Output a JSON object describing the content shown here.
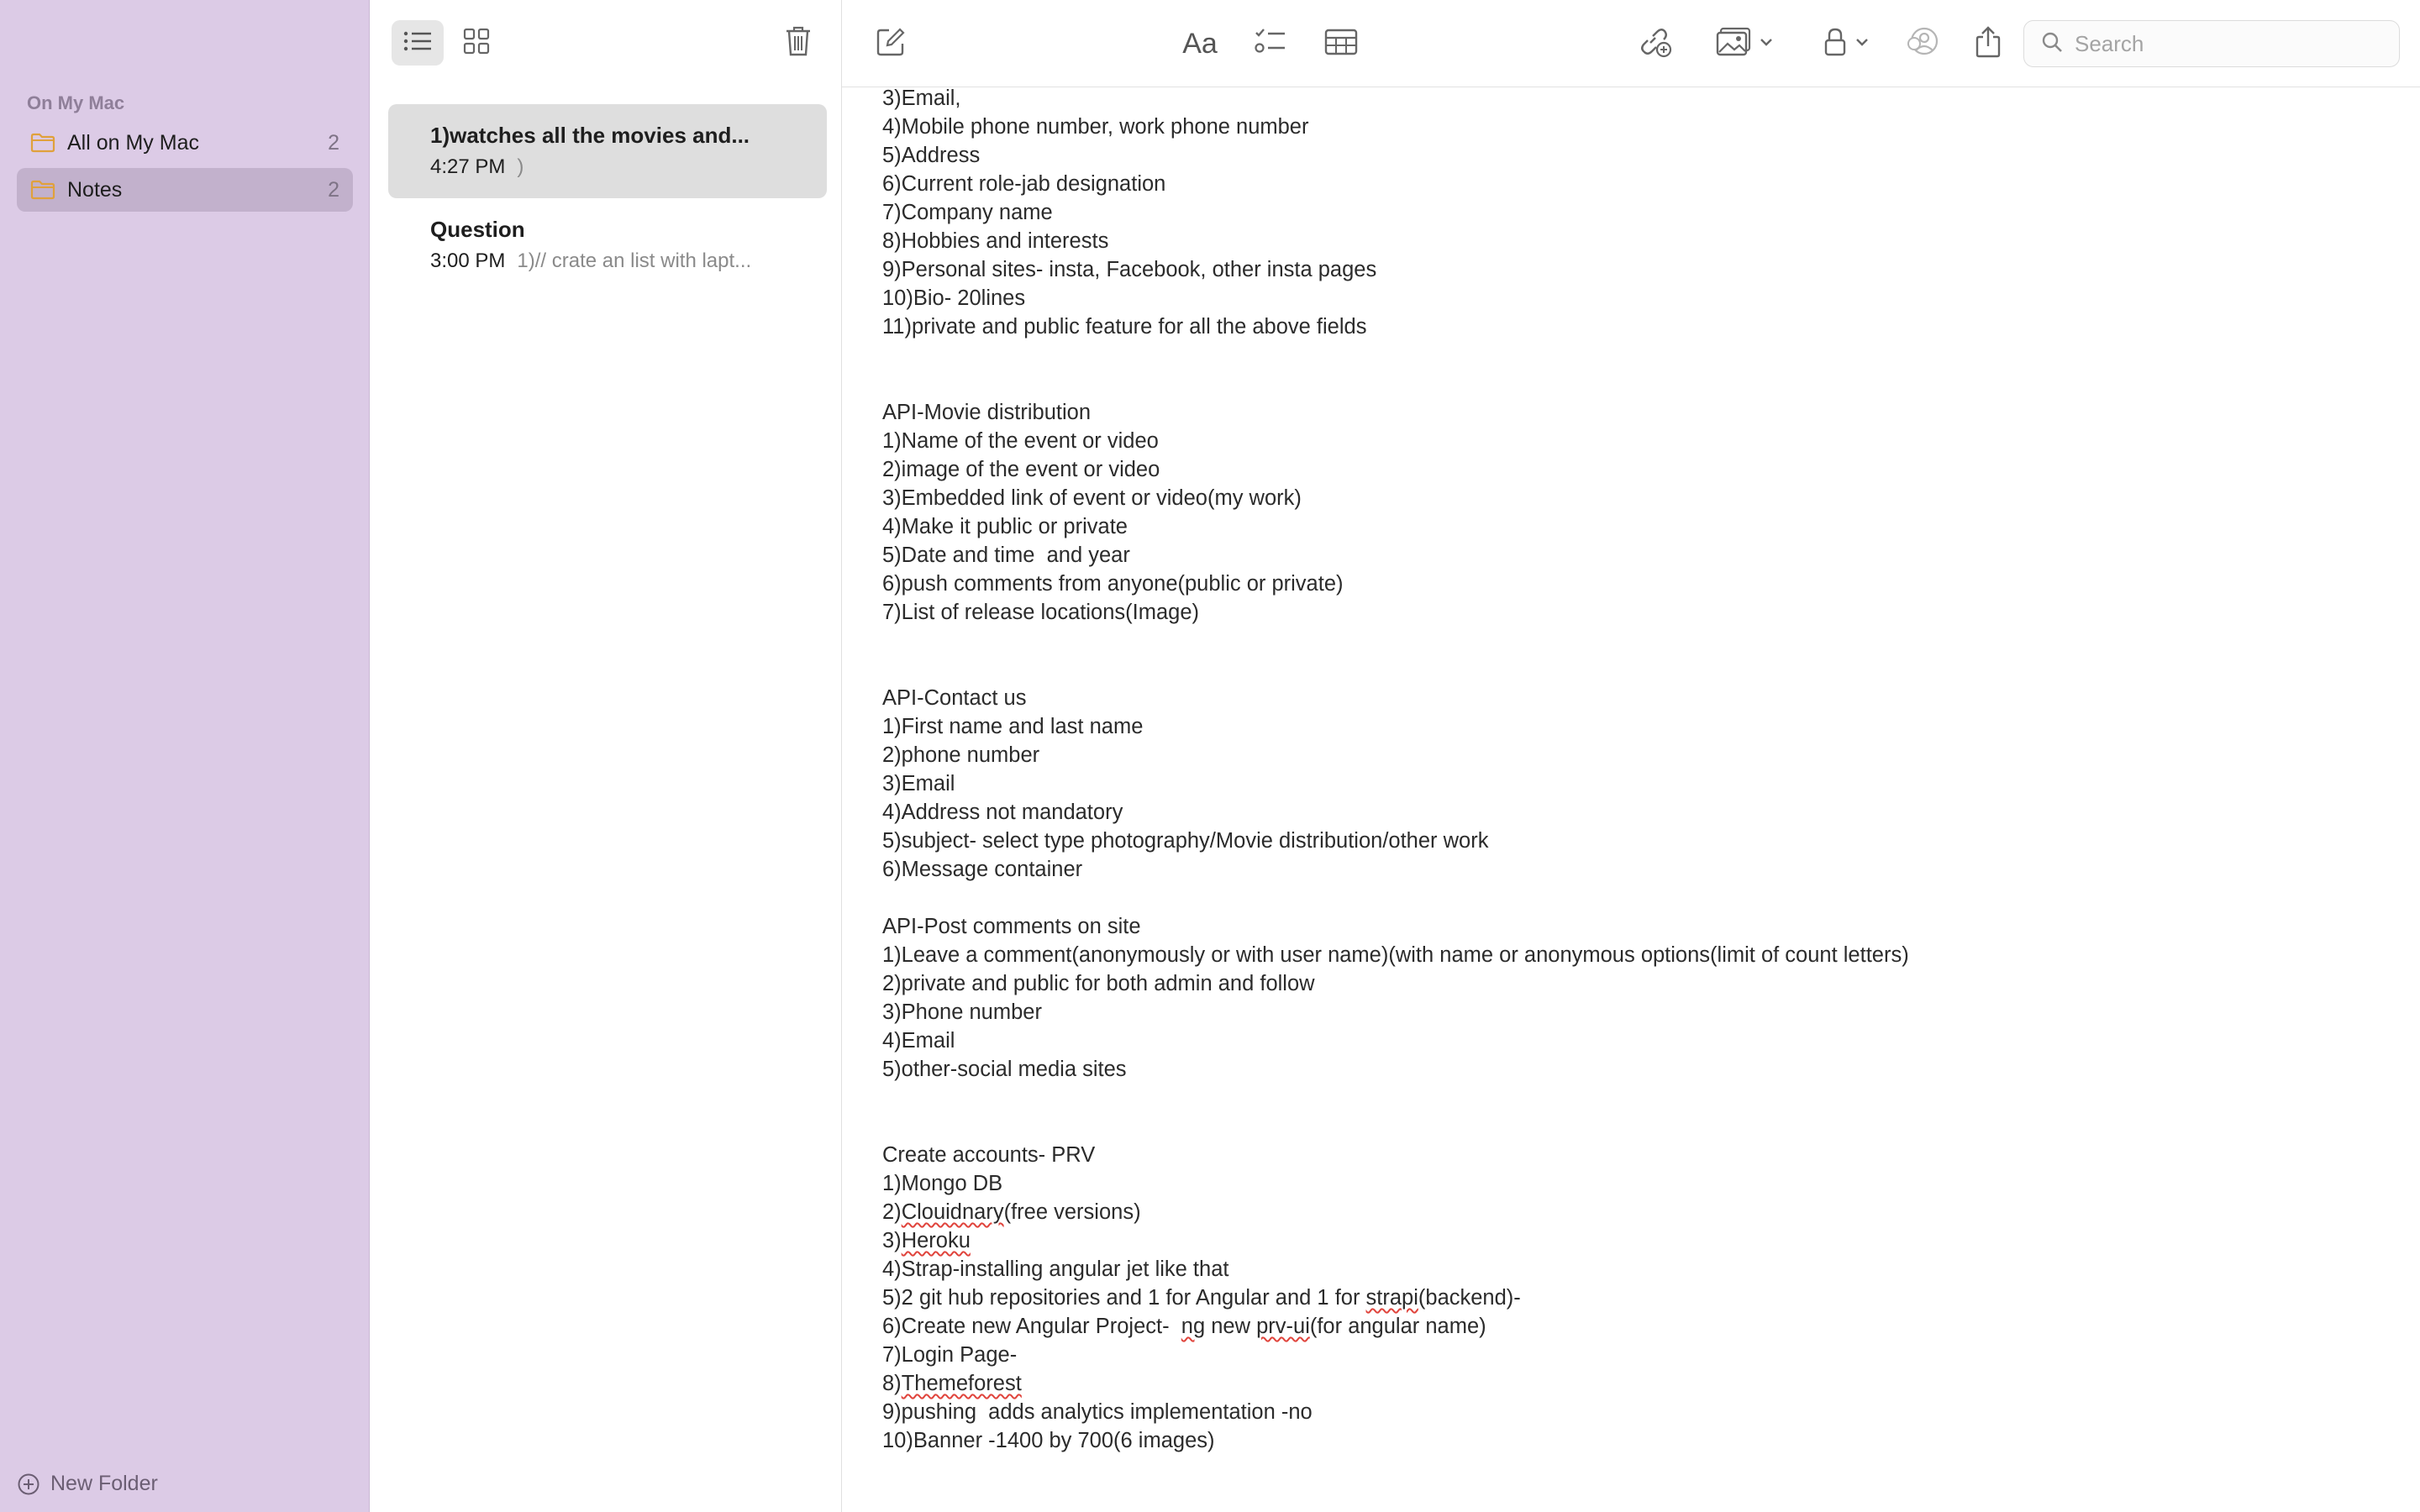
{
  "sidebar": {
    "section_label": "On My Mac",
    "folders": [
      {
        "label": "All on My Mac",
        "count": "2",
        "icon": "folder-icon"
      },
      {
        "label": "Notes",
        "count": "2",
        "icon": "folder-icon"
      }
    ],
    "new_folder_label": "New Folder"
  },
  "notelist": {
    "notes": [
      {
        "title": "1)watches all the movies and...",
        "time": "4:27 PM",
        "preview": ")"
      },
      {
        "title": "Question",
        "time": "3:00 PM",
        "preview": "1)// crate an list with lapt..."
      }
    ]
  },
  "toolbar": {
    "search_placeholder": "Search",
    "icons": [
      "list-view-icon",
      "gallery-view-icon",
      "trash-icon",
      "compose-icon",
      "format-text-icon",
      "checklist-icon",
      "table-icon",
      "collaborate-icon",
      "media-icon",
      "lock-icon",
      "share-person-icon",
      "share-icon",
      "search-icon"
    ],
    "format_label": "Aa"
  },
  "colors": {
    "sidebar_bg": "#dccbe6",
    "folder_selected": "#c2b1cc",
    "folder_icon": "#e0a13c",
    "spell_error": "#e0443c"
  },
  "note_body": {
    "lines": [
      {
        "text": "3)Email,"
      },
      {
        "text": "4)Mobile phone number, work phone number"
      },
      {
        "text": "5)Address"
      },
      {
        "text": "6)Current role-jab designation"
      },
      {
        "text": "7)Company name"
      },
      {
        "text": "8)Hobbies and interests"
      },
      {
        "text": "9)Personal sites- insta, Facebook, other insta pages"
      },
      {
        "text": "10)Bio- 20lines"
      },
      {
        "text": "11)private and public feature for all the above fields"
      },
      {
        "text": ""
      },
      {
        "text": ""
      },
      {
        "text": "API-Movie distribution"
      },
      {
        "text": "1)Name of the event or video"
      },
      {
        "text": "2)image of the event or video"
      },
      {
        "text": "3)Embedded link of event or video(my work)"
      },
      {
        "text": "4)Make it public or private"
      },
      {
        "text": "5)Date and time  and year"
      },
      {
        "text": "6)push comments from anyone(public or private)"
      },
      {
        "text": "7)List of release locations(Image)"
      },
      {
        "text": ""
      },
      {
        "text": ""
      },
      {
        "text": "API-Contact us"
      },
      {
        "text": "1)First name and last name"
      },
      {
        "text": "2)phone number"
      },
      {
        "text": "3)Email"
      },
      {
        "text": "4)Address not mandatory"
      },
      {
        "text": "5)subject- select type photography/Movie distribution/other work"
      },
      {
        "text": "6)Message container"
      },
      {
        "text": ""
      },
      {
        "text": "API-Post comments on site"
      },
      {
        "text": "1)Leave a comment(anonymously or with user name)(with name or anonymous options(limit of count letters)"
      },
      {
        "text": "2)private and public for both admin and follow"
      },
      {
        "text": "3)Phone number"
      },
      {
        "text": "4)Email"
      },
      {
        "text": "5)other-social media sites"
      },
      {
        "text": ""
      },
      {
        "text": ""
      },
      {
        "text": "Create accounts- PRV"
      },
      {
        "text": "1)Mongo DB"
      },
      {
        "parts": [
          "2)",
          "Clouidnary",
          "(free versions)"
        ]
      },
      {
        "parts": [
          "3)",
          "Heroku",
          ""
        ]
      },
      {
        "text": "4)Strap-installing angular jet like that"
      },
      {
        "parts": [
          "5)2 git hub repositories and 1 for Angular and 1 for ",
          "strapi",
          "(backend)-"
        ]
      },
      {
        "parts": [
          "6)Create new Angular Project-  ",
          "ng",
          " new ",
          "prv-ui",
          "(for angular name)"
        ]
      },
      {
        "text": "7)Login Page-"
      },
      {
        "parts": [
          "8)",
          "Themeforest",
          ""
        ]
      },
      {
        "text": "9)pushing  adds analytics implementation -no"
      },
      {
        "text": "10)Banner -1400 by 700(6 images)"
      }
    ]
  }
}
